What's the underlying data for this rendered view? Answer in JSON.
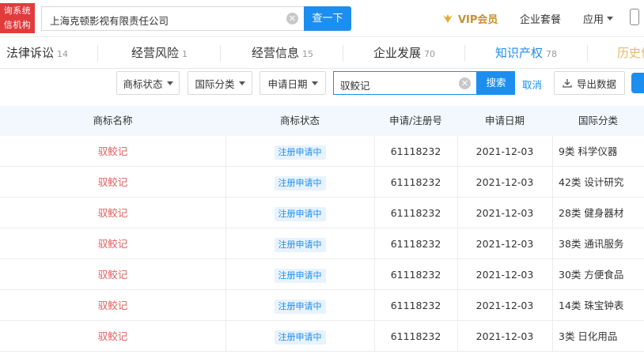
{
  "header": {
    "logo_line1": "询系统",
    "logo_line2": "信机构",
    "search_value": "上海克顿影视有限责任公司",
    "search_button": "查一下",
    "vip_label": "VIP会员",
    "nav_package": "企业套餐",
    "nav_apps": "应用"
  },
  "tabs": [
    {
      "label": "法律诉讼",
      "count": "14"
    },
    {
      "label": "经营风险",
      "count": "1"
    },
    {
      "label": "经营信息",
      "count": "15"
    },
    {
      "label": "企业发展",
      "count": "70"
    },
    {
      "label": "知识产权",
      "count": "78"
    },
    {
      "label": "历史信"
    }
  ],
  "filters": {
    "status_label": "商标状态",
    "class_label": "国际分类",
    "date_label": "申请日期",
    "keyword_value": "驭鲛记",
    "search_button": "搜索",
    "cancel_label": "取消",
    "export_label": "导出数据"
  },
  "table": {
    "headers": [
      "商标名称",
      "商标状态",
      "申请/注册号",
      "申请日期",
      "国际分类"
    ],
    "rows": [
      {
        "name": "驭鲛记",
        "status": "注册申请中",
        "reg_no": "61118232",
        "date": "2021-12-03",
        "class": "9类 科学仪器"
      },
      {
        "name": "驭鲛记",
        "status": "注册申请中",
        "reg_no": "61118232",
        "date": "2021-12-03",
        "class": "42类 设计研究"
      },
      {
        "name": "驭鲛记",
        "status": "注册申请中",
        "reg_no": "61118232",
        "date": "2021-12-03",
        "class": "28类 健身器材"
      },
      {
        "name": "驭鲛记",
        "status": "注册申请中",
        "reg_no": "61118232",
        "date": "2021-12-03",
        "class": "38类 通讯服务"
      },
      {
        "name": "驭鲛记",
        "status": "注册申请中",
        "reg_no": "61118232",
        "date": "2021-12-03",
        "class": "30类 方便食品"
      },
      {
        "name": "驭鲛记",
        "status": "注册申请中",
        "reg_no": "61118232",
        "date": "2021-12-03",
        "class": "14类 珠宝钟表"
      },
      {
        "name": "驭鲛记",
        "status": "注册申请中",
        "reg_no": "61118232",
        "date": "2021-12-03",
        "class": "3类 日化用品"
      }
    ]
  },
  "colors": {
    "accent": "#1c8ef0",
    "brand_red": "#e23b3b",
    "name_red": "#e35d5d",
    "vip_gold": "#c8902f"
  }
}
